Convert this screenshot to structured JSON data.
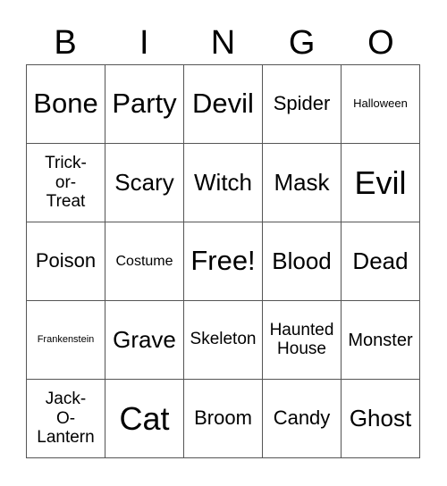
{
  "card": {
    "header": [
      "B",
      "I",
      "N",
      "G",
      "O"
    ],
    "rows": [
      [
        "Bone",
        "Party",
        "Devil",
        "Spider",
        "Halloween"
      ],
      [
        "Trick-or-Treat",
        "Scary",
        "Witch",
        "Mask",
        "Evil"
      ],
      [
        "Poison",
        "Costume",
        "Free!",
        "Blood",
        "Dead"
      ],
      [
        "Frankenstein",
        "Grave",
        "Skeleton",
        "Haunted House",
        "Monster"
      ],
      [
        "Jack-O-Lantern",
        "Cat",
        "Broom",
        "Candy",
        "Ghost"
      ]
    ],
    "display_lines": {
      "r1c0": [
        "Trick-",
        "or-",
        "Treat"
      ],
      "r3c3": [
        "Haunted",
        "House"
      ],
      "r4c0": [
        "Jack-",
        "O-",
        "Lantern"
      ]
    },
    "free_space": "Free!"
  }
}
